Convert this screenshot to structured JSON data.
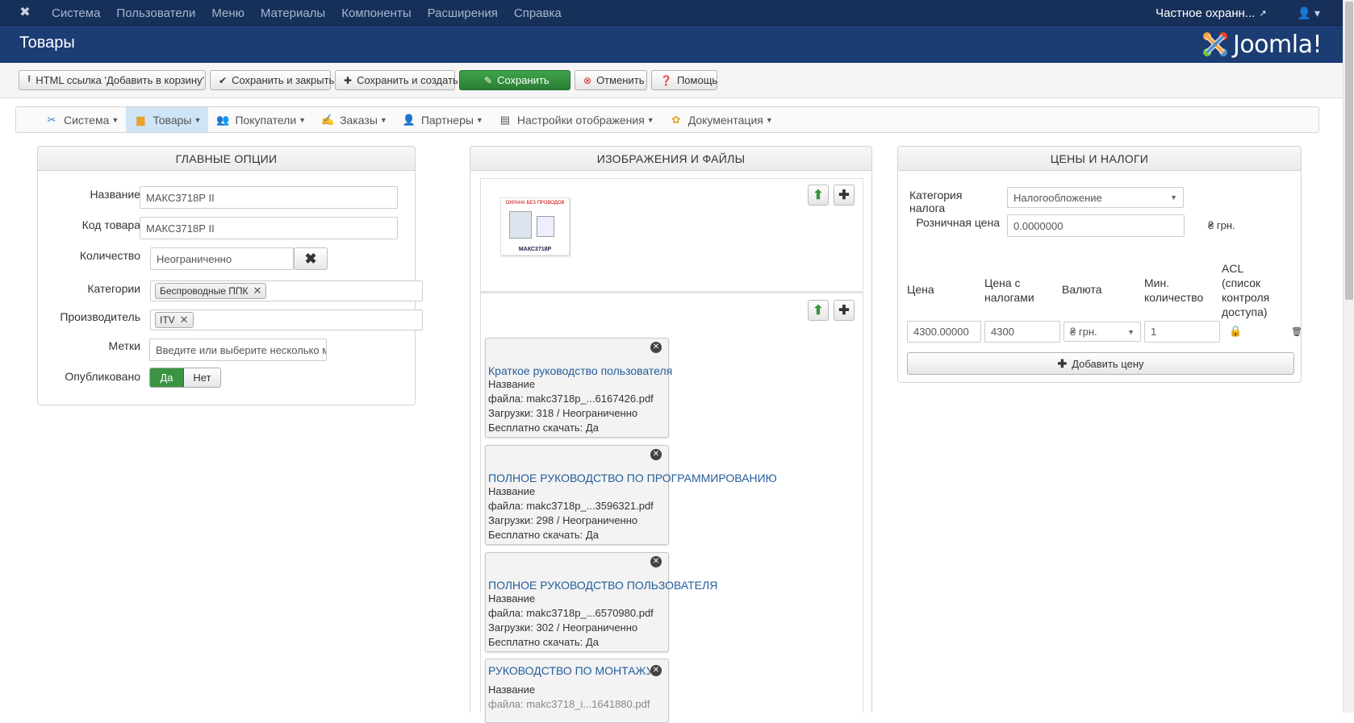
{
  "topbar": {
    "menu": [
      "Система",
      "Пользователи",
      "Меню",
      "Материалы",
      "Компоненты",
      "Расширения",
      "Справка"
    ],
    "site_name": "Частное охранн...",
    "user_icon": "user-icon"
  },
  "header": {
    "title": "Товары",
    "logo_text": "Joomla!"
  },
  "toolbar": {
    "html_link": "HTML ссылка 'Добавить в корзину'",
    "save_close": "Сохранить и закрыть",
    "save_new": "Сохранить и создать",
    "save": "Сохранить",
    "cancel": "Отменить",
    "help": "Помощь"
  },
  "nav": [
    {
      "label": "Система",
      "icon": "tools-icon"
    },
    {
      "label": "Товары",
      "icon": "box-icon",
      "active": true
    },
    {
      "label": "Покупатели",
      "icon": "users-icon"
    },
    {
      "label": "Заказы",
      "icon": "order-icon"
    },
    {
      "label": "Партнеры",
      "icon": "partner-icon"
    },
    {
      "label": "Настройки отображения",
      "icon": "display-icon"
    },
    {
      "label": "Документация",
      "icon": "docs-icon"
    }
  ],
  "main_options": {
    "title": "ГЛАВНЫЕ ОПЦИИ",
    "name_label": "Название",
    "name_value": "МАКС3718Р II",
    "sku_label": "Код товара",
    "sku_value": "МАКС3718Р II",
    "qty_label": "Количество",
    "qty_value": "Неограниченно",
    "cat_label": "Категории",
    "cat_chip": "Беспроводные ППК",
    "maker_label": "Производитель",
    "maker_chip": "ITV",
    "tags_label": "Метки",
    "tags_placeholder": "Введите или выберите несколько м",
    "pub_label": "Опубликовано",
    "pub_yes": "Да",
    "pub_no": "Нет"
  },
  "images": {
    "title": "ИЗОБРАЖЕНИЯ И ФАЙЛЫ",
    "product_thumb_caption": "МАКС3718Р",
    "thumb_banner_left": "ОХРАНА",
    "thumb_banner_right": "БЕЗ ПРОВОДОВ",
    "files": [
      {
        "title": "Краткое руководство пользователя",
        "name_label": "Название",
        "file": "файла: makc3718p_...6167426.pdf",
        "downloads": "Загрузки: 318 / Неограниченно",
        "free": "Бесплатно скачать: Да"
      },
      {
        "title": "ПОЛНОЕ РУКОВОДСТВО ПО ПРОГРАММИРОВАНИЮ",
        "name_label": "Название",
        "file": "файла: makc3718p_...3596321.pdf",
        "downloads": "Загрузки: 298 / Неограниченно",
        "free": "Бесплатно скачать: Да"
      },
      {
        "title": "ПОЛНОЕ РУКОВОДСТВО ПОЛЬЗОВАТЕЛЯ",
        "name_label": "Название",
        "file": "файла: makc3718p_...6570980.pdf",
        "downloads": "Загрузки: 302 / Неограниченно",
        "free": "Бесплатно скачать: Да"
      },
      {
        "title": "РУКОВОДСТВО ПО МОНТАЖУ",
        "name_label": "Название",
        "file": "файла: makc3718_i...1641880.pdf"
      }
    ]
  },
  "prices": {
    "title": "ЦЕНЫ И НАЛОГИ",
    "tax_label": "Категория налога",
    "tax_value": "Налогообложение",
    "retail_label": "Розничная цена",
    "retail_value": "0.0000000",
    "retail_currency": "₴ грн.",
    "col_price": "Цена",
    "col_price_tax_1": "Цена с",
    "col_price_tax_2": "налогами",
    "col_currency": "Валюта",
    "col_min_1": "Мин.",
    "col_min_2": "количество",
    "col_acl_1": "ACL",
    "col_acl_2": "(список",
    "col_acl_3": "контроля",
    "col_acl_4": "доступа)",
    "row_price": "4300.00000",
    "row_price_tax": "4300",
    "row_currency": "₴ грн.",
    "row_min": "1",
    "add_price": "Добавить цену"
  }
}
